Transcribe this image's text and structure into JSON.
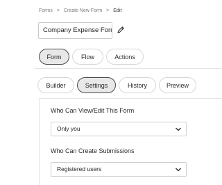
{
  "breadcrumb": {
    "items": [
      "Forms",
      "Create New Form",
      "Edit"
    ],
    "separator": ">"
  },
  "form": {
    "title": "Company Expense Form",
    "edit_icon": "pencil-icon"
  },
  "primary_tabs": {
    "items": [
      "Form",
      "Flow",
      "Actions"
    ],
    "active": "Form"
  },
  "secondary_tabs": {
    "items": [
      "Builder",
      "Settings",
      "History",
      "Preview"
    ],
    "active": "Settings"
  },
  "settings": {
    "view_edit_label": "Who Can View/Edit This Form",
    "view_edit_value": "Only you",
    "create_submissions_label": "Who Can Create Submissions",
    "create_submissions_value": "Registered users",
    "dropdown_icon": "chevron-down-icon"
  },
  "colors": {
    "active_pill_bg": "#e8e8e8",
    "active_pill_border": "#4a4a4a",
    "border": "#d6d6d6"
  }
}
